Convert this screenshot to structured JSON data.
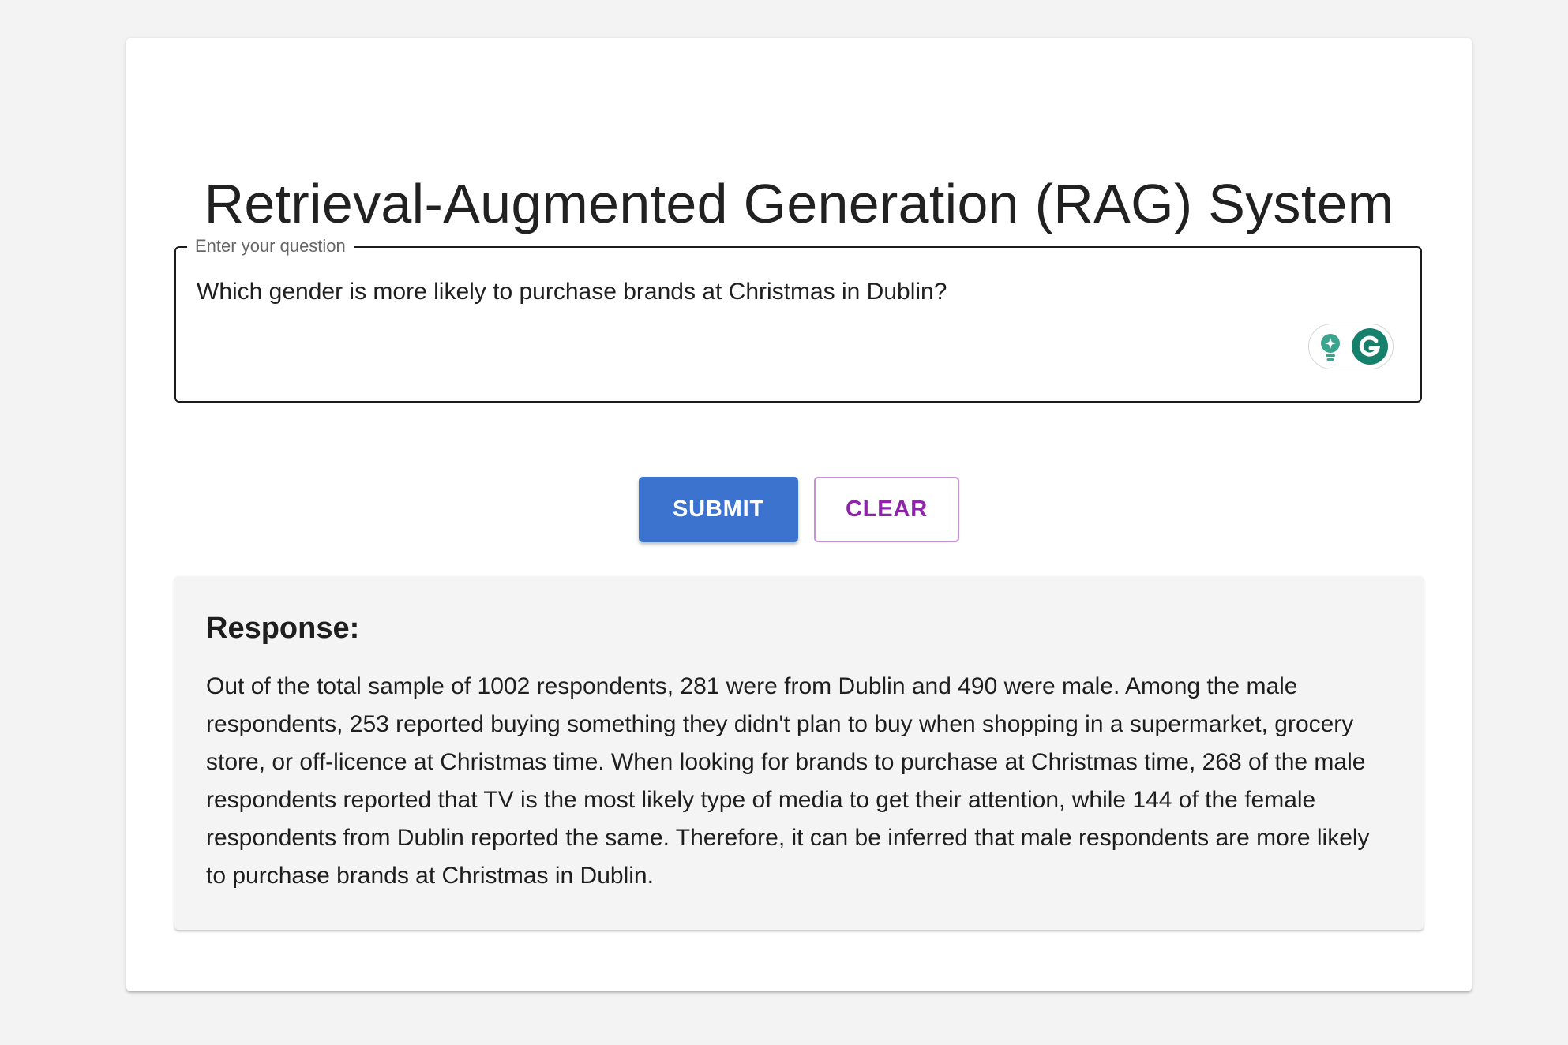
{
  "page": {
    "title": "Retrieval-Augmented Generation (RAG) System"
  },
  "question": {
    "label": "Enter your question",
    "value": "Which gender is more likely to purchase brands at Christmas in Dublin?"
  },
  "extension": {
    "icons": [
      "lightbulb-icon",
      "grammarly-icon"
    ],
    "colors": {
      "bulb": "#3aa58e",
      "grammarly": "#15806c"
    }
  },
  "actions": {
    "submit_label": "SUBMIT",
    "clear_label": "CLEAR"
  },
  "response": {
    "heading": "Response:",
    "text": "Out of the total sample of 1002 respondents, 281 were from Dublin and 490 were male. Among the male respondents, 253 reported buying something they didn't plan to buy when shopping in a supermarket, grocery store, or off-licence at Christmas time. When looking for brands to purchase at Christmas time, 268 of the male respondents reported that TV is the most likely type of media to get their attention, while 144 of the female respondents from Dublin reported the same. Therefore, it can be inferred that male respondents are more likely to purchase brands at Christmas in Dublin."
  },
  "theme": {
    "primary": "#3b73ce",
    "secondary": "#8e24aa",
    "background": "#f3f3f3"
  }
}
